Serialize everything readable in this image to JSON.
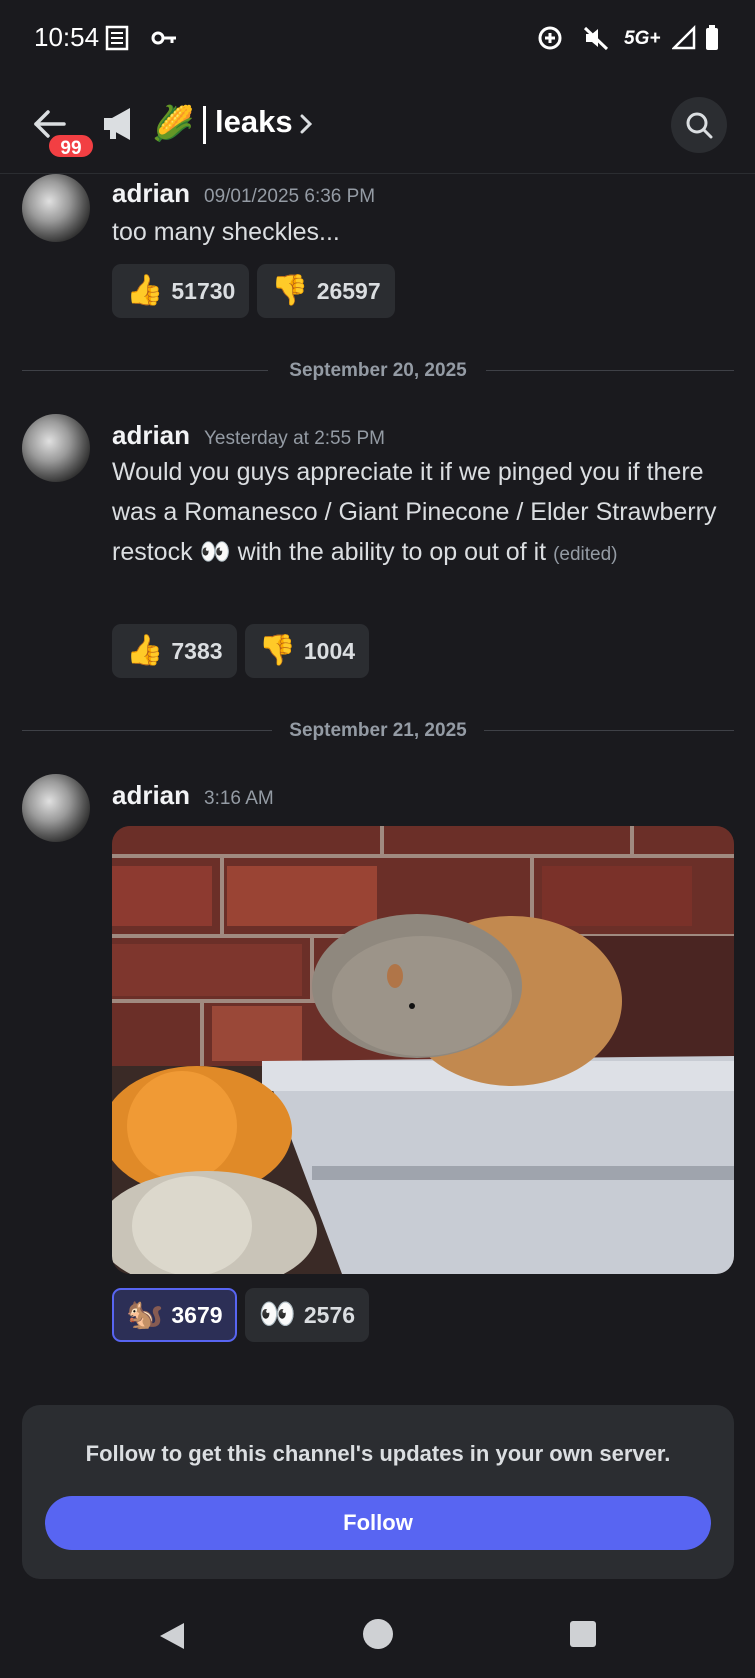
{
  "status_bar": {
    "time": "10:54",
    "network": "5G+"
  },
  "header": {
    "back_badge": "99",
    "emoji": "🌽",
    "channel_name": "leaks"
  },
  "messages": [
    {
      "author": "adrian",
      "timestamp": "09/01/2025 6:36 PM",
      "text": "too many sheckles...",
      "reactions": [
        {
          "emoji": "👍",
          "count": "51730"
        },
        {
          "emoji": "👎",
          "count": "26597"
        }
      ]
    },
    {
      "author": "adrian",
      "timestamp": "Yesterday at 2:55 PM",
      "text": "Would you guys appreciate it if we pinged you if there was a Romanesco / Giant Pinecone / Elder Strawberry restock 👀 with the ability to op out of it",
      "edited": "(edited)",
      "reactions": [
        {
          "emoji": "👍",
          "count": "7383"
        },
        {
          "emoji": "👎",
          "count": "1004"
        }
      ]
    },
    {
      "author": "adrian",
      "timestamp": "3:16 AM",
      "reactions": [
        {
          "emoji": "🐿️",
          "count": "3679"
        },
        {
          "emoji": "👀",
          "count": "2576"
        }
      ]
    }
  ],
  "dividers": [
    "September 20, 2025",
    "September 21, 2025"
  ],
  "follow": {
    "text": "Follow to get this channel's updates in your own server.",
    "button": "Follow"
  },
  "colors": {
    "background": "#1a1a1e",
    "accent": "#5865f2",
    "badge": "#f23f43"
  }
}
